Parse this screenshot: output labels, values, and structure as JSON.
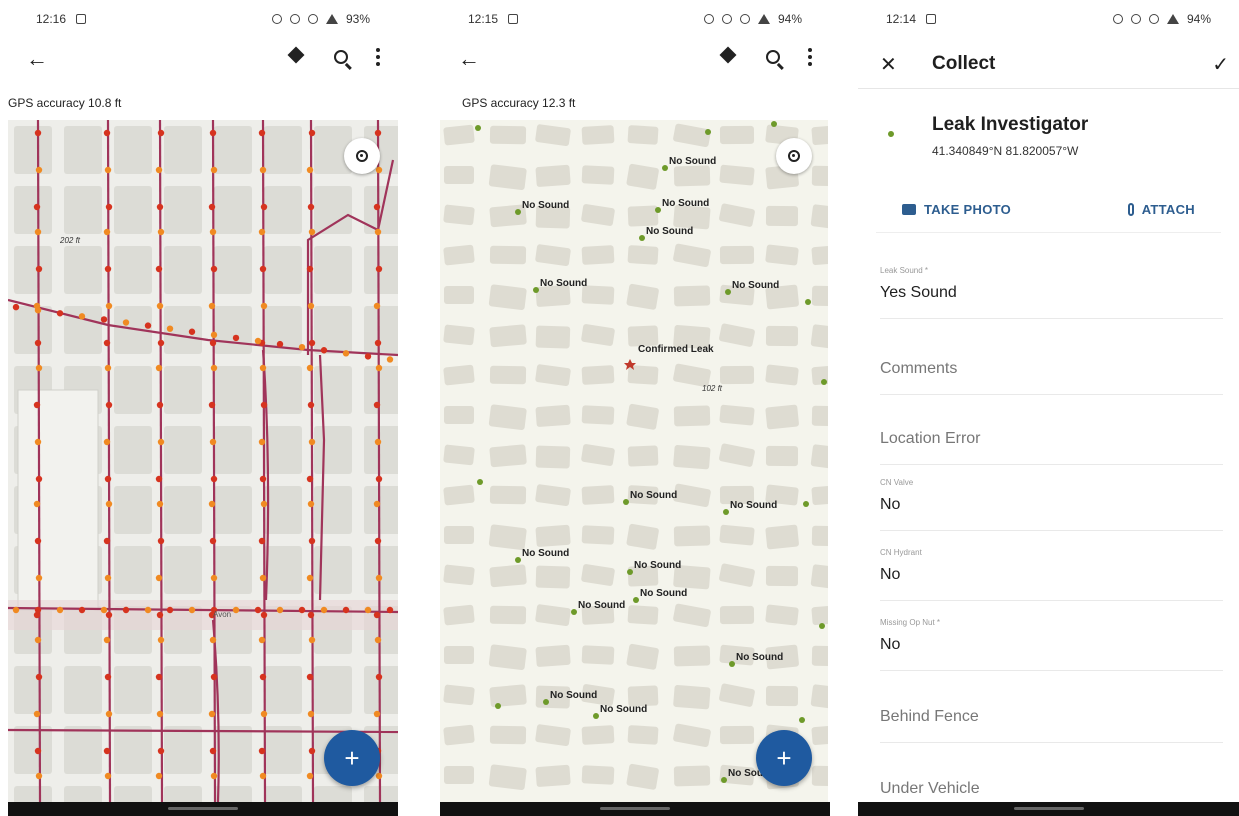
{
  "panels": {
    "map_pipes": {
      "status": {
        "time": "12:16",
        "battery": "93%"
      },
      "gps_accuracy": "GPS accuracy 10.8 ft",
      "distance_label": "202 ft",
      "road_label": "Avon"
    },
    "map_sounds": {
      "status": {
        "time": "12:15",
        "battery": "94%"
      },
      "gps_accuracy": "GPS accuracy 12.3 ft",
      "distance_label": "102 ft",
      "labels": {
        "no_sound": "No Sound",
        "confirmed_leak": "Confirmed Leak"
      }
    },
    "collect_form": {
      "status": {
        "time": "12:14",
        "battery": "94%"
      },
      "title": "Collect",
      "feature_name": "Leak Investigator",
      "feature_coords": "41.340849°N 81.820057°W",
      "take_photo": "TAKE PHOTO",
      "attach": "ATTACH",
      "fields": [
        {
          "label": "Leak Sound *",
          "value": "Yes Sound",
          "placeholder": false
        },
        {
          "label": "",
          "value": "Comments",
          "placeholder": true
        },
        {
          "label": "",
          "value": "Location Error",
          "placeholder": true
        },
        {
          "label": "CN Valve",
          "value": "No",
          "placeholder": false
        },
        {
          "label": "CN Hydrant",
          "value": "No",
          "placeholder": false
        },
        {
          "label": "Missing Op Nut *",
          "value": "No",
          "placeholder": false
        },
        {
          "label": "",
          "value": "Behind Fence",
          "placeholder": true
        },
        {
          "label": "",
          "value": "Under Vehicle",
          "placeholder": true
        }
      ]
    }
  },
  "colors": {
    "accent_blue": "#1f5aa0",
    "action_blue": "#2d5d8f",
    "pipe": "#a0345a",
    "fitting_orange": "#f08a22",
    "valve_red": "#d6331f",
    "sound_green": "#6e9a2a",
    "leak_red": "#c0392b"
  }
}
